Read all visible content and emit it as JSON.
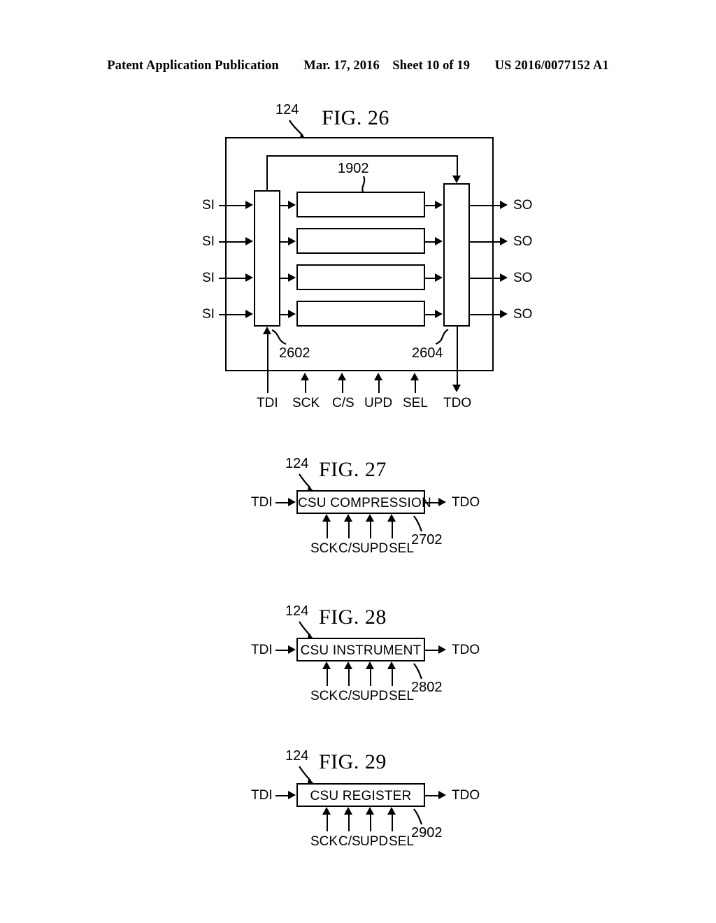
{
  "header": {
    "publication": "Patent Application Publication",
    "date": "Mar. 17, 2016",
    "sheet": "Sheet 10 of 19",
    "docnum": "US 2016/0077152 A1"
  },
  "figures": [
    {
      "id": "fig26",
      "title": "FIG. 26",
      "outer_ref": "124",
      "inner_refs": {
        "core": "1902",
        "left_block": "2602",
        "right_block": "2604"
      },
      "scan_inputs": [
        "SI",
        "SI",
        "SI",
        "SI"
      ],
      "scan_outputs": [
        "SO",
        "SO",
        "SO",
        "SO"
      ],
      "control_signals": [
        "TDI",
        "SCK",
        "C/S",
        "UPD",
        "SEL",
        "TDO"
      ]
    },
    {
      "id": "fig27",
      "title": "FIG. 27",
      "outer_ref": "124",
      "block_label": "CSU COMPRESSION",
      "block_ref": "2702",
      "input_label": "TDI",
      "output_label": "TDO",
      "control_signals": [
        "SCK",
        "C/S",
        "UPD",
        "SEL"
      ]
    },
    {
      "id": "fig28",
      "title": "FIG. 28",
      "outer_ref": "124",
      "block_label": "CSU INSTRUMENT",
      "block_ref": "2802",
      "input_label": "TDI",
      "output_label": "TDO",
      "control_signals": [
        "SCK",
        "C/S",
        "UPD",
        "SEL"
      ]
    },
    {
      "id": "fig29",
      "title": "FIG. 29",
      "outer_ref": "124",
      "block_label": "CSU REGISTER",
      "block_ref": "2902",
      "input_label": "TDI",
      "output_label": "TDO",
      "control_signals": [
        "SCK",
        "C/S",
        "UPD",
        "SEL"
      ]
    }
  ],
  "colors": {
    "ink": "#000000",
    "paper": "#ffffff"
  }
}
